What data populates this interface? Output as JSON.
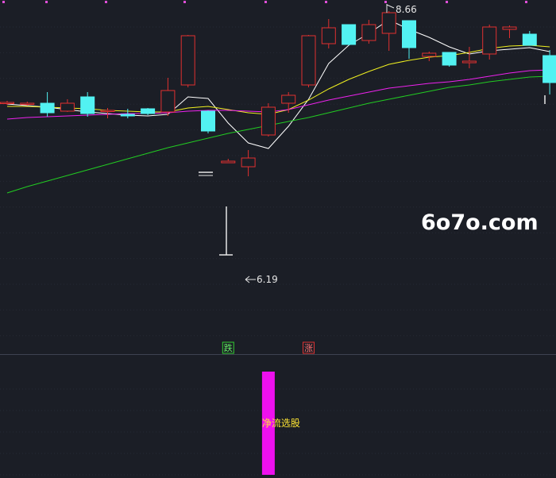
{
  "watermark": "6o7o.com",
  "colors": {
    "background": "#1b1e26",
    "up": "#e03030",
    "down": "#52f2f2",
    "ma_fast": "#ffffff",
    "ma_mid": "#f0f020",
    "ma_slow": "#ee22ee",
    "ma_long": "#22cc22",
    "indicator": "#ee10ee",
    "signal_down": "#33cc33",
    "signal_up": "#dd3333"
  },
  "chart_data": [
    {
      "type": "candlestick",
      "ylim": [
        4.4,
        8.8
      ],
      "grid": true,
      "high_label": "8.66",
      "low_label": "6.19",
      "candles": [
        {
          "o": 7.51,
          "h": 7.53,
          "l": 7.48,
          "c": 7.51
        },
        {
          "o": 7.49,
          "h": 7.52,
          "l": 7.47,
          "c": 7.5
        },
        {
          "o": 7.5,
          "h": 7.64,
          "l": 7.33,
          "c": 7.38
        },
        {
          "o": 7.4,
          "h": 7.55,
          "l": 7.39,
          "c": 7.5
        },
        {
          "o": 7.58,
          "h": 7.64,
          "l": 7.33,
          "c": 7.37
        },
        {
          "o": 7.4,
          "h": 7.44,
          "l": 7.31,
          "c": 7.41
        },
        {
          "o": 7.36,
          "h": 7.43,
          "l": 7.31,
          "c": 7.34
        },
        {
          "o": 7.43,
          "h": 7.44,
          "l": 7.35,
          "c": 7.37
        },
        {
          "o": 7.39,
          "h": 7.82,
          "l": 7.34,
          "c": 7.66
        },
        {
          "o": 7.73,
          "h": 8.36,
          "l": 7.7,
          "c": 8.35
        },
        {
          "o": 7.4,
          "h": 7.41,
          "l": 7.12,
          "c": 7.15
        },
        {
          "o": 6.75,
          "h": 6.8,
          "l": 6.76,
          "c": 6.77
        },
        {
          "o": 6.7,
          "h": 6.91,
          "l": 6.58,
          "c": 6.81
        },
        {
          "o": 7.1,
          "h": 7.5,
          "l": 7.08,
          "c": 7.45
        },
        {
          "o": 7.5,
          "h": 7.64,
          "l": 7.38,
          "c": 7.6
        },
        {
          "o": 7.73,
          "h": 8.36,
          "l": 7.7,
          "c": 8.35
        },
        {
          "o": 8.25,
          "h": 8.56,
          "l": 8.19,
          "c": 8.45
        },
        {
          "o": 8.49,
          "h": 8.49,
          "l": 8.23,
          "c": 8.24
        },
        {
          "o": 8.29,
          "h": 8.55,
          "l": 8.25,
          "c": 8.49
        },
        {
          "o": 8.38,
          "h": 8.66,
          "l": 8.16,
          "c": 8.64
        },
        {
          "o": 8.54,
          "h": 8.54,
          "l": 8.06,
          "c": 8.2
        },
        {
          "o": 8.09,
          "h": 8.15,
          "l": 8.03,
          "c": 8.13
        },
        {
          "o": 8.14,
          "h": 8.14,
          "l": 7.96,
          "c": 7.98
        },
        {
          "o": 8.01,
          "h": 8.21,
          "l": 7.94,
          "c": 8.03
        },
        {
          "o": 8.12,
          "h": 8.49,
          "l": 8.05,
          "c": 8.46
        },
        {
          "o": 8.43,
          "h": 8.48,
          "l": 8.32,
          "c": 8.46
        },
        {
          "o": 8.37,
          "h": 8.41,
          "l": 8.23,
          "c": 8.23
        },
        {
          "o": 8.1,
          "h": 8.17,
          "l": 7.61,
          "c": 7.76
        }
      ],
      "series": [
        {
          "values": [
            7.49,
            7.47,
            7.45,
            7.42,
            7.39,
            7.37,
            7.35,
            7.34,
            7.36,
            7.58,
            7.56,
            7.25,
            7.0,
            6.93,
            7.21,
            7.55,
            8.0,
            8.23,
            8.38,
            8.55,
            8.43,
            8.33,
            8.21,
            8.12,
            8.16,
            8.18,
            8.2,
            8.15
          ]
        },
        {
          "values": [
            7.46,
            7.46,
            7.45,
            7.44,
            7.43,
            7.41,
            7.4,
            7.39,
            7.39,
            7.44,
            7.46,
            7.42,
            7.38,
            7.36,
            7.42,
            7.54,
            7.68,
            7.8,
            7.9,
            7.99,
            8.04,
            8.08,
            8.1,
            8.14,
            8.19,
            8.22,
            8.23,
            8.21
          ]
        },
        {
          "values": [
            7.3,
            7.32,
            7.33,
            7.34,
            7.35,
            7.36,
            7.37,
            7.37,
            7.38,
            7.4,
            7.41,
            7.41,
            7.4,
            7.39,
            7.42,
            7.48,
            7.54,
            7.59,
            7.64,
            7.69,
            7.72,
            7.75,
            7.77,
            7.8,
            7.84,
            7.88,
            7.91,
            7.92
          ]
        },
        {
          "values": [
            6.37,
            6.45,
            6.52,
            6.59,
            6.66,
            6.73,
            6.8,
            6.87,
            6.94,
            7.0,
            7.06,
            7.12,
            7.17,
            7.22,
            7.27,
            7.32,
            7.38,
            7.44,
            7.5,
            7.55,
            7.6,
            7.65,
            7.7,
            7.73,
            7.77,
            7.8,
            7.83,
            7.84
          ]
        }
      ]
    },
    {
      "type": "bar",
      "ylim": [
        0,
        1
      ],
      "signals": [
        {
          "index": 11,
          "label": "跌"
        },
        {
          "index": 15,
          "label": "涨"
        }
      ],
      "bars": [
        {
          "index": 13,
          "value": 1.0,
          "label": "净流选股"
        }
      ]
    }
  ]
}
